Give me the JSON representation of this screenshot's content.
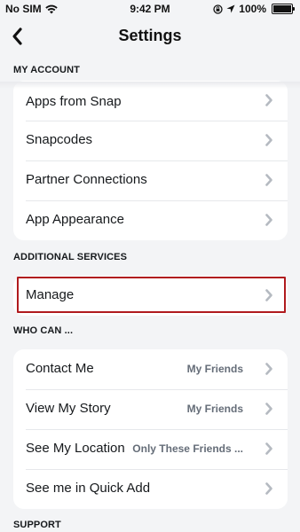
{
  "status": {
    "carrier": "No SIM",
    "time": "9:42 PM",
    "battery": "100%"
  },
  "header": {
    "title": "Settings"
  },
  "sections": {
    "my_account": {
      "title": "MY ACCOUNT",
      "items": [
        {
          "label": "Apps from Snap"
        },
        {
          "label": "Snapcodes"
        },
        {
          "label": "Partner Connections"
        },
        {
          "label": "App Appearance"
        }
      ]
    },
    "additional_services": {
      "title": "ADDITIONAL SERVICES",
      "items": [
        {
          "label": "Manage"
        }
      ]
    },
    "who_can": {
      "title": "WHO CAN ...",
      "items": [
        {
          "label": "Contact Me",
          "value": "My Friends"
        },
        {
          "label": "View My Story",
          "value": "My Friends"
        },
        {
          "label": "See My Location",
          "value": "Only These Friends ..."
        },
        {
          "label": "See me in Quick Add",
          "value": ""
        }
      ]
    },
    "support": {
      "title": "SUPPORT"
    }
  },
  "colors": {
    "background": "#f3f4f6",
    "card": "#ffffff",
    "highlight": "#b01a1e",
    "chevron": "#b5bac1"
  }
}
